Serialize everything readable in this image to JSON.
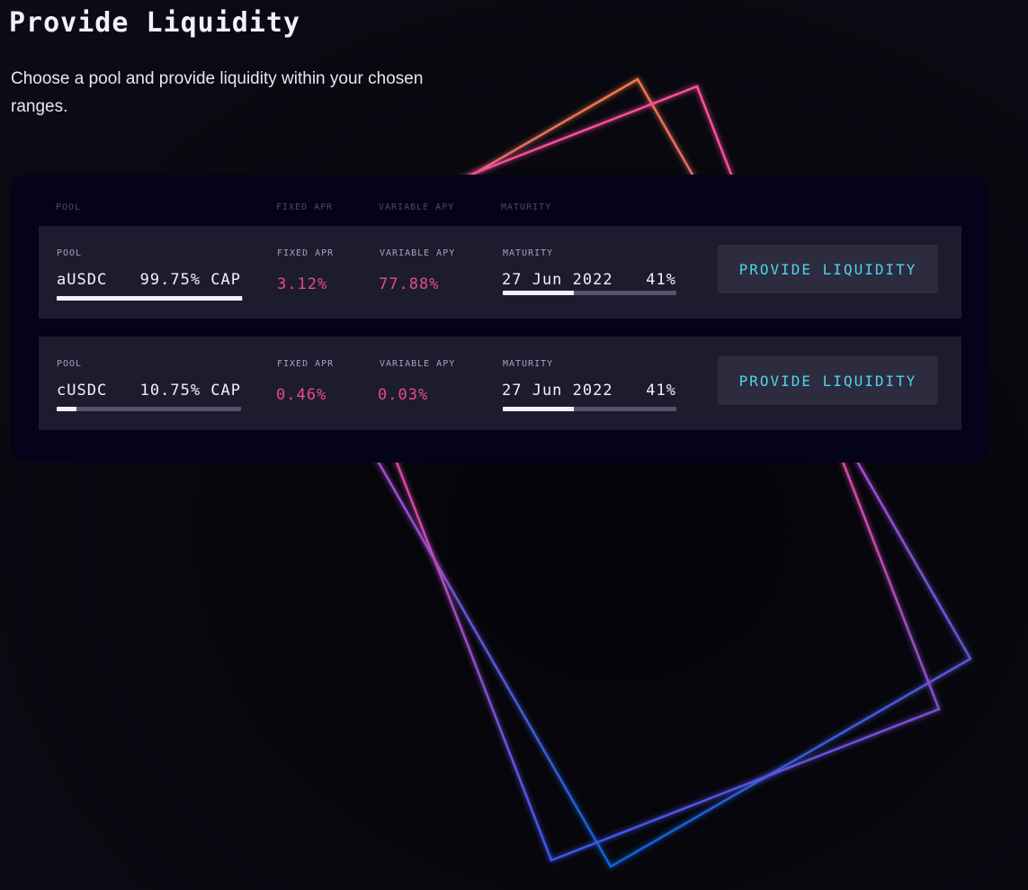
{
  "page": {
    "title": "Provide Liquidity",
    "subtitle": "Choose a pool and provide liquidity within your chosen ranges."
  },
  "table": {
    "headers": {
      "pool": "POOL",
      "fixed_apr": "FIXED APR",
      "variable_apy": "VARIABLE APY",
      "maturity": "MATURITY"
    },
    "rows": [
      {
        "pool_label": "POOL",
        "pool": "aUSDC",
        "cap": "99.75% CAP",
        "cap_fraction": 0.9975,
        "fixed_apr_label": "FIXED APR",
        "fixed_apr": "3.12%",
        "variable_apy_label": "VARIABLE APY",
        "variable_apy": "77.88%",
        "maturity_label": "MATURITY",
        "maturity_date": "27 Jun 2022",
        "maturity_pct": "41%",
        "maturity_fraction": 0.41,
        "button_label": "PROVIDE LIQUIDITY"
      },
      {
        "pool_label": "POOL",
        "pool": "cUSDC",
        "cap": "10.75% CAP",
        "cap_fraction": 0.1075,
        "fixed_apr_label": "FIXED APR",
        "fixed_apr": "0.46%",
        "variable_apy_label": "VARIABLE APY",
        "variable_apy": "0.03%",
        "maturity_label": "MATURITY",
        "maturity_date": "27 Jun 2022",
        "maturity_pct": "41%",
        "maturity_fraction": 0.41,
        "button_label": "PROVIDE LIQUIDITY"
      }
    ]
  },
  "colors": {
    "accent_cyan": "#4fd3ee",
    "accent_pink": "#e8498f",
    "panel": "#04031a",
    "row": "#1d1c2e",
    "button": "#2d2c3f"
  }
}
